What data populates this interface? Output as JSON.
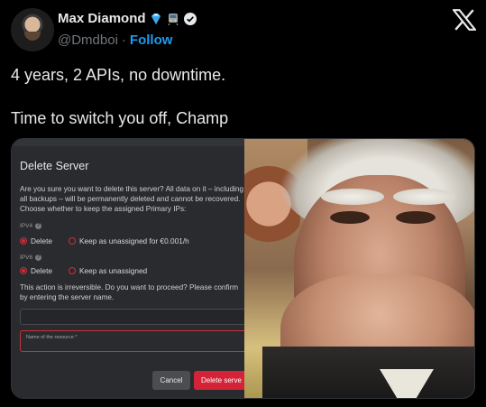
{
  "author": {
    "name": "Max Diamond",
    "handle": "@Dmdboi",
    "separator": "·",
    "follow_label": "Follow",
    "badges": [
      "diamond-emoji",
      "train-emoji",
      "verified-badge"
    ]
  },
  "platform_icon": "x-logo",
  "tweet": {
    "line1": "4 years, 2 APIs, no downtime.",
    "line2": "Time to switch you off, Champ"
  },
  "dialog": {
    "title": "Delete Server",
    "body": "Are you sure you want to delete this server? All data on it – including all backups – will be permanently deleted and cannot be recovered. Choose whether to keep the assigned Primary IPs:",
    "ipv4_label": "IPV4",
    "ipv4_options": [
      "Delete",
      "Keep as unassigned for €0.001/h"
    ],
    "ipv6_label": "IPV6",
    "ipv6_options": [
      "Delete",
      "Keep as unassigned"
    ],
    "confirm_text": "This action is irreversible. Do you want to proceed? Please confirm by entering the server name.",
    "resource_placeholder": "Name of the resource *",
    "cancel_label": "Cancel",
    "delete_label": "Delete serve"
  },
  "colors": {
    "accent_blue": "#1d9bf0",
    "danger_red": "#d42237",
    "background": "#000000"
  }
}
